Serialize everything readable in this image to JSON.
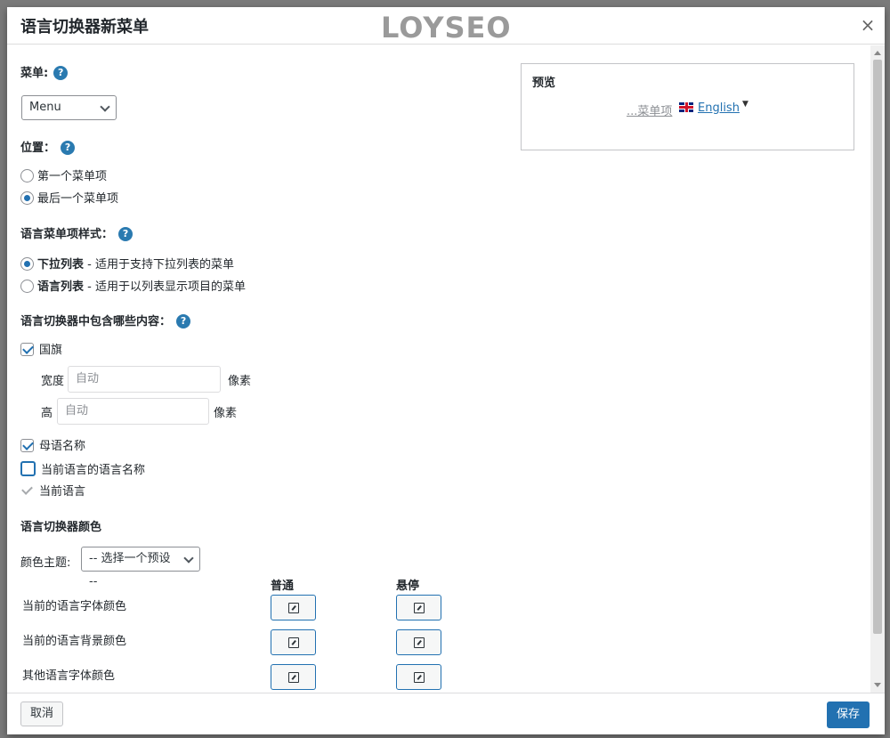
{
  "dialog": {
    "title": "语言切换器新菜单",
    "watermark": "LOYSEO",
    "close_icon": "×"
  },
  "menu_section": {
    "label": "菜单:",
    "help": "?",
    "select_value": "Menu"
  },
  "position_section": {
    "label": "位置：",
    "help": "?",
    "options": [
      {
        "label": "第一个菜单项",
        "selected": false
      },
      {
        "label": "最后一个菜单项",
        "selected": true
      }
    ]
  },
  "style_section": {
    "label": "语言菜单项样式：",
    "help": "?",
    "options": [
      {
        "name": "下拉列表",
        "desc": " - 适用于支持下拉列表的菜单",
        "selected": true
      },
      {
        "name": "语言列表",
        "desc": " - 适用于以列表显示项目的菜单",
        "selected": false
      }
    ]
  },
  "content_section": {
    "label": "语言切换器中包含哪些内容：",
    "help": "?",
    "flag": {
      "label": "国旗",
      "checked": true
    },
    "width": {
      "label": "宽度",
      "placeholder": "自动",
      "unit": "像素"
    },
    "height": {
      "label": "高",
      "placeholder": "自动",
      "unit": "像素"
    },
    "native_name": {
      "label": "母语名称",
      "checked": true
    },
    "current_lang_name": {
      "label": "当前语言的语言名称",
      "checked": false
    },
    "current_lang": {
      "label": "当前语言",
      "checked": true,
      "disabled": true
    }
  },
  "colors_section": {
    "label": "语言切换器颜色",
    "theme_label": "颜色主题:",
    "theme_value": "-- 选择一个预设 --",
    "col_normal": "普通",
    "col_hover": "悬停",
    "rows": [
      {
        "label": "当前的语言字体颜色"
      },
      {
        "label": "当前的语言背景颜色"
      },
      {
        "label": "其他语言字体颜色"
      }
    ]
  },
  "preview": {
    "title": "预览",
    "menu_item": "...菜单项",
    "language": "English",
    "caret": "▼"
  },
  "footer": {
    "cancel": "取消",
    "save": "保存"
  }
}
